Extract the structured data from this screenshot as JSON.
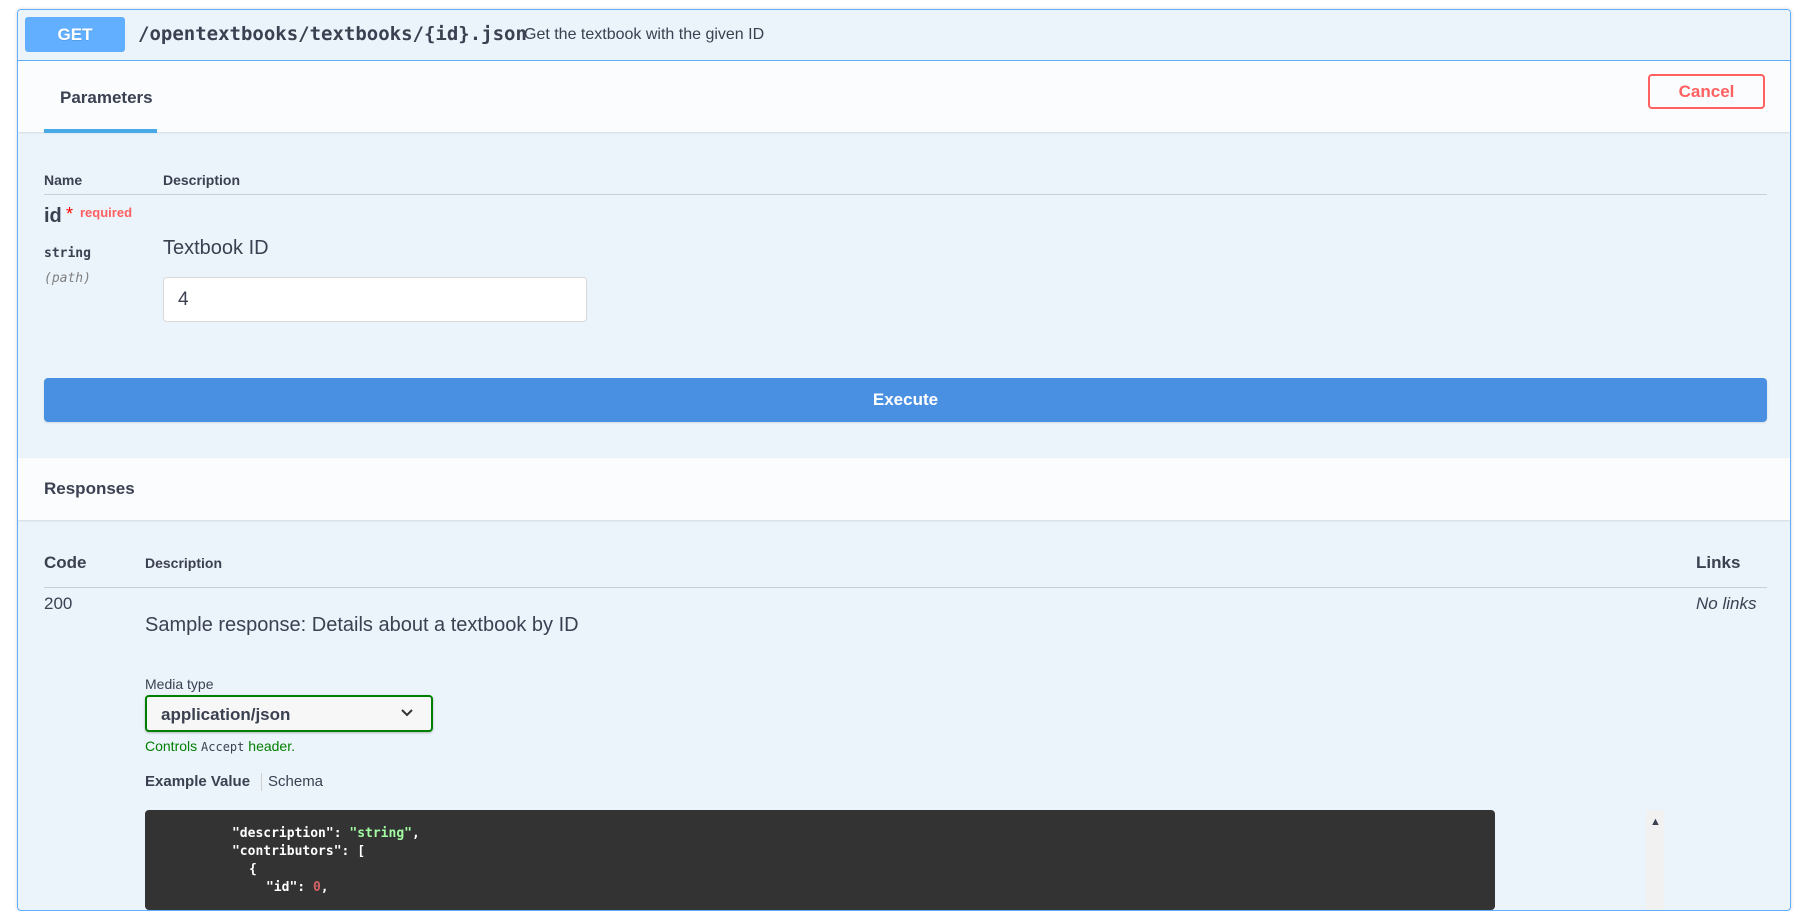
{
  "operation": {
    "method": "GET",
    "path": "/opentextbooks/textbooks/{id}.json",
    "summary": "Get the textbook with the given ID"
  },
  "parameters_section": {
    "tab_label": "Parameters",
    "cancel_label": "Cancel",
    "col_name": "Name",
    "col_description": "Description",
    "param": {
      "name": "id",
      "star": "*",
      "required_label": "required",
      "type": "string",
      "in": "(path)",
      "description": "Textbook ID",
      "value": "4"
    },
    "execute_label": "Execute"
  },
  "responses_section": {
    "title": "Responses",
    "col_code": "Code",
    "col_description": "Description",
    "col_links": "Links",
    "response": {
      "code": "200",
      "description": "Sample response: Details about a textbook by ID",
      "links": "No links",
      "media_type_label": "Media type",
      "media_type_value": "application/json",
      "controls_prefix": "Controls",
      "controls_code": "Accept",
      "controls_suffix": "header.",
      "tab_example": "Example Value",
      "tab_schema": "Schema",
      "code_lines": [
        {
          "key": "\"description\"",
          "sep": ": ",
          "val": "\"string\"",
          "val_type": "string",
          "end": ","
        },
        {
          "key": "\"contributors\"",
          "sep": ": ",
          "val": "[",
          "val_type": "punct",
          "end": ""
        },
        {
          "key": "{",
          "sep": "",
          "val": "",
          "val_type": "punct",
          "end": ""
        },
        {
          "key": "\"id\"",
          "sep": ": ",
          "val": "0",
          "val_type": "number",
          "end": ","
        }
      ]
    }
  },
  "colors": {
    "get_accent": "#61affe",
    "execute_blue": "#4990e2",
    "cancel_red": "#ff6060",
    "select_green": "#008000"
  },
  "icons": [
    "chevron-down-icon",
    "scroll-up-arrow-icon"
  ]
}
